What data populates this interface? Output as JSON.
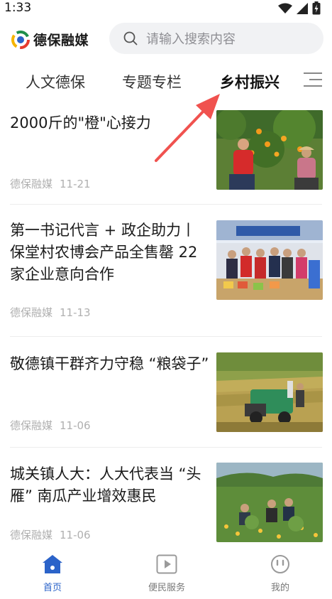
{
  "status_bar": {
    "time": "1:33"
  },
  "header": {
    "logo_text": "德保融媒",
    "search_placeholder": "请输入搜索内容"
  },
  "tabs": [
    {
      "label": "人文德保",
      "active": false
    },
    {
      "label": "专题专栏",
      "active": false
    },
    {
      "label": "乡村振兴",
      "active": true
    }
  ],
  "news": [
    {
      "title": "2000斤的\"橙\"心接力",
      "source": "德保融媒",
      "date": "11-21",
      "thumb_icon": "orange-harvest-photo"
    },
    {
      "title": "第一书记代言 + 政企助力丨保堂村农博会产品全售罄 22家企业意向合作",
      "source": "德保融媒",
      "date": "11-13",
      "thumb_icon": "expo-booth-photo"
    },
    {
      "title": "敬德镇干群齐力守稳 “粮袋子”",
      "source": "德保融媒",
      "date": "11-06",
      "thumb_icon": "rice-harvester-photo"
    },
    {
      "title": "城关镇人大：人大代表当 “头雁” 南瓜产业增效惠民",
      "source": "德保融媒",
      "date": "11-06",
      "thumb_icon": "pumpkin-field-photo"
    }
  ],
  "bottom_nav": [
    {
      "label": "首页",
      "icon": "home-icon",
      "active": true
    },
    {
      "label": "便民服务",
      "icon": "play-icon",
      "active": false
    },
    {
      "label": "我的",
      "icon": "smile-icon",
      "active": false
    }
  ],
  "colors": {
    "accent": "#2b63c9",
    "arrow": "#f0524f",
    "meta": "#b0b0b0"
  }
}
